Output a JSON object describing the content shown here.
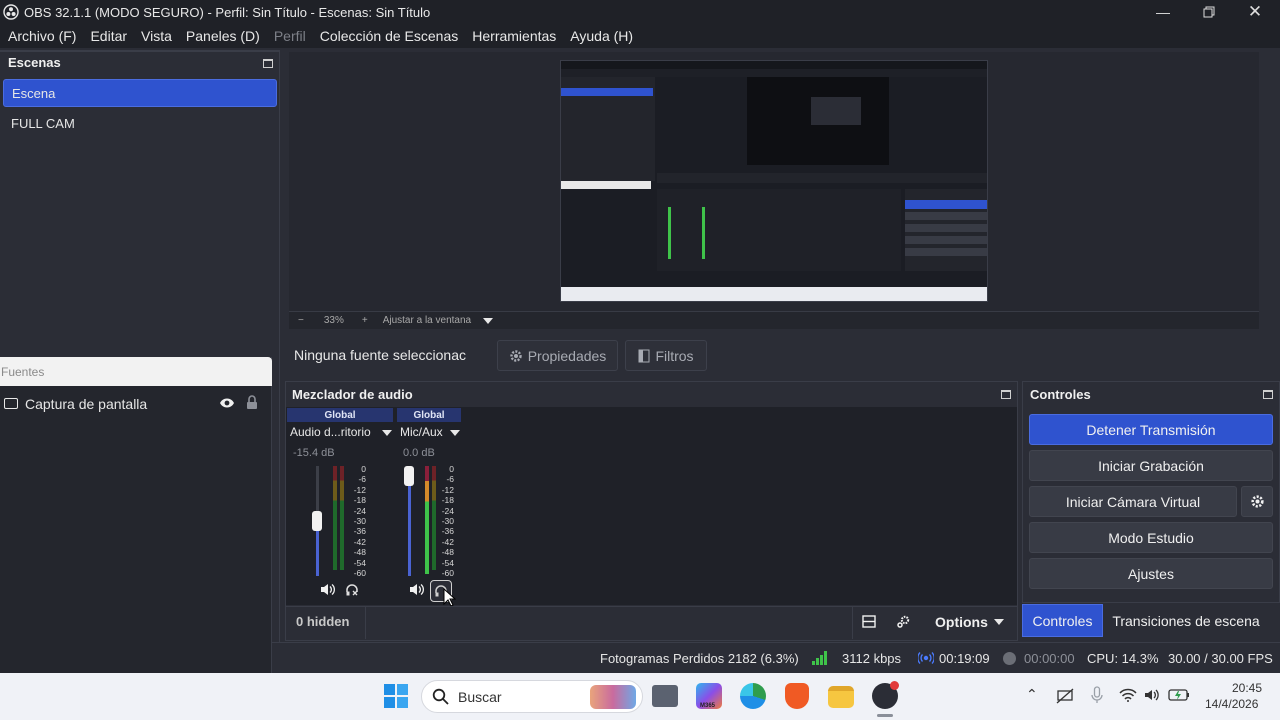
{
  "window": {
    "title": "OBS 32.1.1 (MODO SEGURO) - Perfil: Sin Título - Escenas: Sin Título",
    "minimize_icon": "minimize-icon",
    "maximize_icon": "restore-icon",
    "close_icon": "close-icon"
  },
  "menu": {
    "items": [
      "Archivo (F)",
      "Editar",
      "Vista",
      "Paneles (D)",
      "Perfil",
      "Colección de Escenas",
      "Herramientas",
      "Ayuda (H)"
    ]
  },
  "scenes": {
    "title": "Escenas",
    "items": [
      "Escena",
      "FULL CAM"
    ],
    "selected": "Escena"
  },
  "preview": {
    "zoom_out": "−",
    "zoom": "33%",
    "zoom_in": "+",
    "fit_label": "Ajustar a la ventana"
  },
  "context": {
    "no_source": "Ninguna fuente seleccionac",
    "properties": "Propiedades",
    "filters": "Filtros"
  },
  "sources": {
    "title": "Fuentes",
    "items": [
      {
        "name": "Captura de pantalla",
        "visible": true,
        "locked": false
      }
    ]
  },
  "mixer": {
    "title": "Mezclador de audio",
    "channels": [
      {
        "header": "Global",
        "name": "Audio d...ritorio",
        "db": "-15.4 dB",
        "volume_fraction": 0.5
      },
      {
        "header": "Global",
        "name": "Mic/Aux",
        "db": "0.0 dB",
        "volume_fraction": 1.0
      }
    ],
    "scale": [
      "0",
      "-6",
      "-12",
      "-18",
      "-24",
      "-30",
      "-36",
      "-42",
      "-48",
      "-54",
      "-60"
    ],
    "hidden_label": "0 hidden",
    "options_label": "Options"
  },
  "controls": {
    "title": "Controles",
    "stop_stream": "Detener Transmisión",
    "start_record": "Iniciar Grabación",
    "start_vcam": "Iniciar Cámara Virtual",
    "studio_mode": "Modo Estudio",
    "settings": "Ajustes",
    "tabs": [
      "Controles",
      "Transiciones de escena"
    ],
    "active_tab": "Controles"
  },
  "status": {
    "dropped": "Fotogramas Perdidos 2182 (6.3%)",
    "bitrate": "3112 kbps",
    "stream_time": "00:19:09",
    "rec_time": "00:00:00",
    "cpu": "CPU: 14.3%",
    "fps": "30.00 / 30.00 FPS"
  },
  "taskbar": {
    "search_placeholder": "Buscar",
    "time": "20:45",
    "date": "14/4/2026",
    "m365_label": "M365"
  },
  "colors": {
    "accent": "#2f53cf",
    "meter_green": "#3fc34a",
    "meter_yellow": "#d9c12a",
    "meter_red": "#d23a3a"
  }
}
